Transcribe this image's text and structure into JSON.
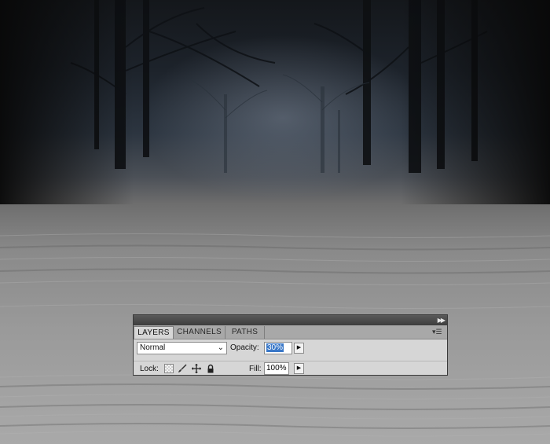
{
  "panel": {
    "tabs": [
      {
        "label": "LAYERS",
        "active": true
      },
      {
        "label": "CHANNELS",
        "active": false
      },
      {
        "label": "PATHS",
        "active": false
      }
    ],
    "blend_mode": {
      "value": "Normal"
    },
    "opacity": {
      "label": "Opacity:",
      "value": "30%"
    },
    "lock": {
      "label": "Lock:",
      "icons": [
        "lock-transparent-icon",
        "brush-icon",
        "move-icon",
        "padlock-icon"
      ]
    },
    "fill": {
      "label": "Fill:",
      "value": "100%"
    },
    "icons": {
      "collapse": "double-chevron-right-icon",
      "menu": "panel-menu-icon",
      "stepper": "triangle-right-icon"
    }
  },
  "colors": {
    "panel_bg": "#d6d6d6",
    "titlebar": "#4a4a4a",
    "selection": "#3a78c8"
  }
}
